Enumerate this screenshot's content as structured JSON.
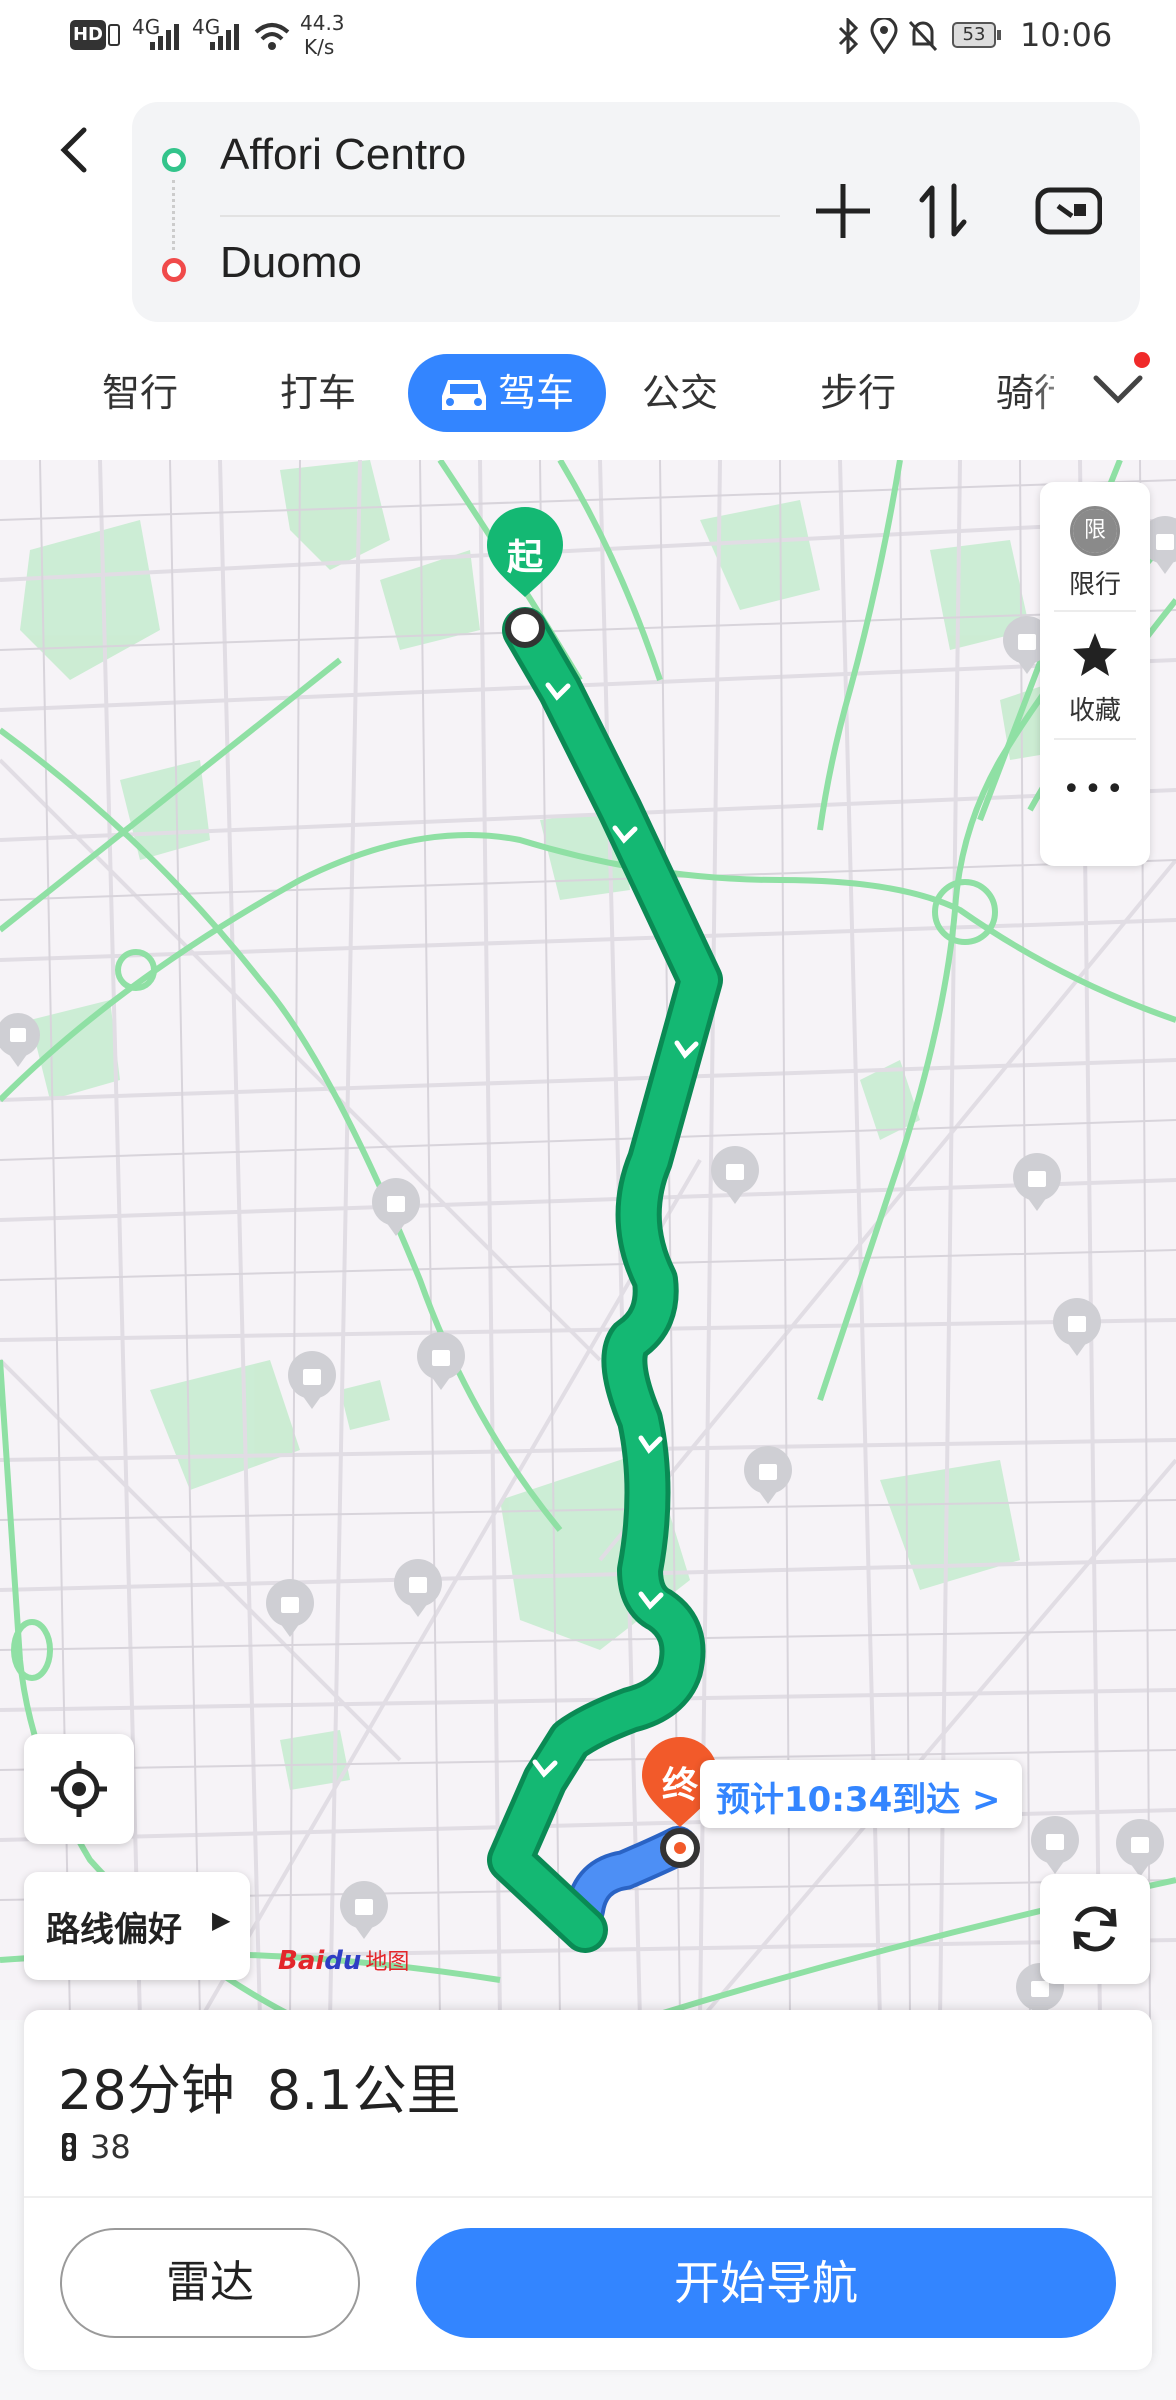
{
  "status_bar": {
    "hd_label": "HD",
    "net1": "4G",
    "net2": "4G",
    "speed_value": "44.3",
    "speed_unit": "K/s",
    "battery": "53",
    "time": "10:06"
  },
  "route": {
    "origin": "Affori Centro",
    "destination": "Duomo",
    "origin_color": "#33c48b",
    "destination_color": "#f04a4a"
  },
  "tabs": [
    {
      "label": "智行"
    },
    {
      "label": "打车"
    },
    {
      "label": "驾车",
      "active": true
    },
    {
      "label": "公交"
    },
    {
      "label": "步行"
    },
    {
      "label": "骑行"
    }
  ],
  "map": {
    "start_marker": "起",
    "end_marker": "终",
    "eta_text": "预计10:34到达 >",
    "route_color": "#14b873",
    "logo_text_a": "Bai",
    "logo_text_b": "du",
    "logo_text_c": "地图"
  },
  "side_panel": {
    "restrict_icon": "限",
    "restrict_label": "限行",
    "favorite_label": "收藏",
    "more_label": "•••"
  },
  "controls": {
    "route_pref_label": "路线偏好",
    "route_pref_arrow": "▶"
  },
  "summary": {
    "duration": "28分钟",
    "distance": "8.1公里",
    "traffic_lights": "38"
  },
  "buttons": {
    "radar": "雷达",
    "start_navigation": "开始导航"
  },
  "colors": {
    "accent": "#3385ff",
    "start_green": "#14b873",
    "end_orange": "#f25a2a"
  }
}
